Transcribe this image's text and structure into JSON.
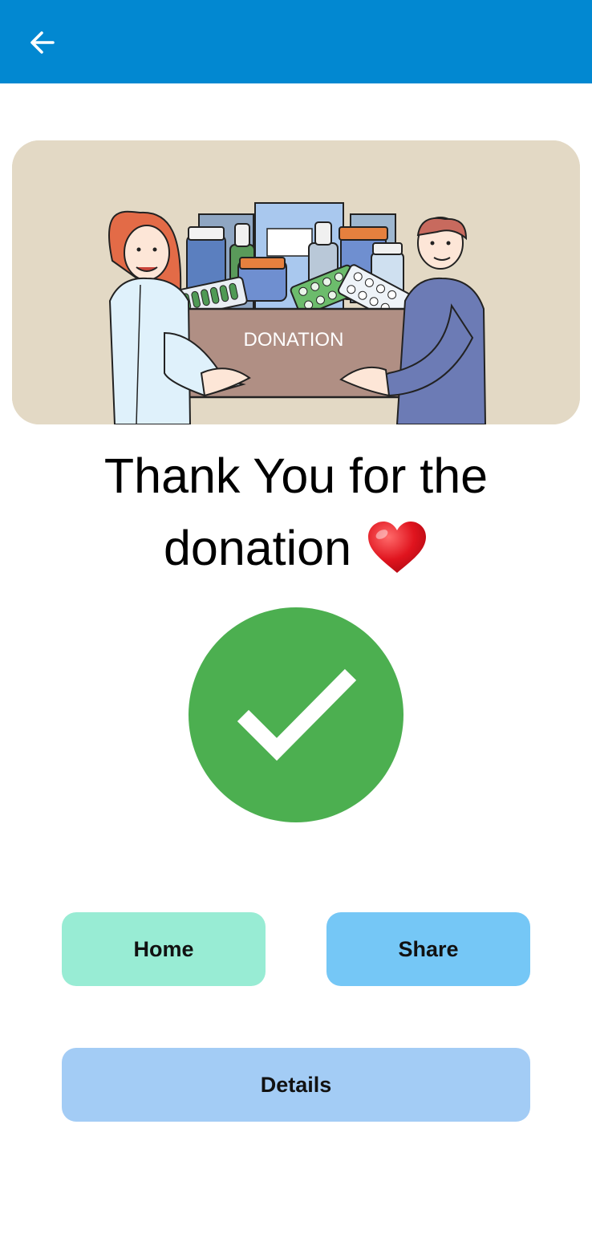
{
  "header": {
    "back_icon": "arrow-left-icon",
    "color": "#0288d1"
  },
  "hero": {
    "box_label": "DONATION",
    "background": "#e3d9c5"
  },
  "message": {
    "line1": "Thank You for the",
    "line2": "donation",
    "emoji_icon": "heart-icon"
  },
  "status": {
    "icon": "check-circle-icon",
    "color": "#4caf50"
  },
  "buttons": {
    "home": "Home",
    "share": "Share",
    "details": "Details"
  }
}
